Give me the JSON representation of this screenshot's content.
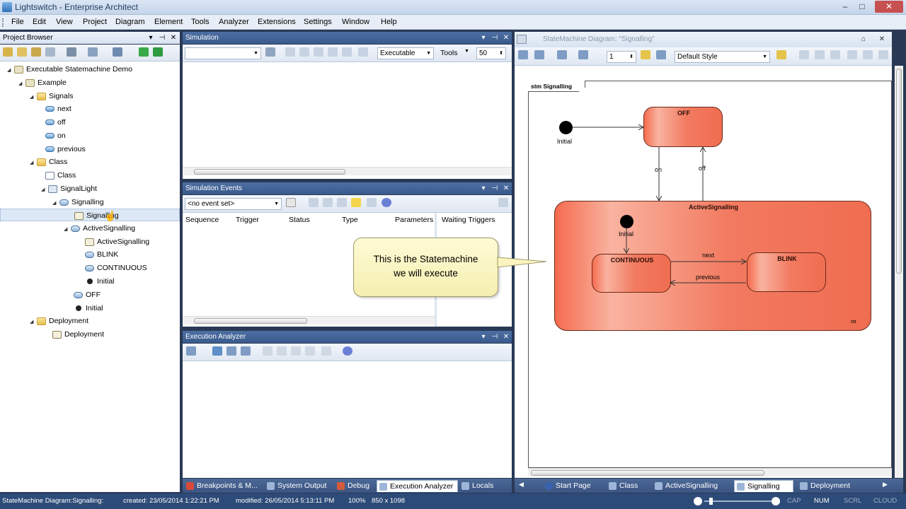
{
  "window": {
    "title": "Lightswitch - Enterprise Architect",
    "minimize": "–",
    "maximize": "□",
    "close": "✕"
  },
  "menu": [
    "File",
    "Edit",
    "View",
    "Project",
    "Diagram",
    "Element",
    "Tools",
    "Analyzer",
    "Extensions",
    "Settings",
    "Window",
    "Help"
  ],
  "project_browser": {
    "title": "Project Browser",
    "items": [
      {
        "label": "Executable Statemachine Demo",
        "icon": "model-icon",
        "expander": "◢"
      },
      {
        "label": "Example",
        "icon": "package-icon",
        "expander": "◢"
      },
      {
        "label": "Signals",
        "icon": "folder-icon",
        "expander": "◢"
      },
      {
        "label": "next",
        "icon": "signal-icon",
        "expander": ""
      },
      {
        "label": "off",
        "icon": "signal-icon",
        "expander": ""
      },
      {
        "label": "on",
        "icon": "signal-icon",
        "expander": ""
      },
      {
        "label": "previous",
        "icon": "signal-icon",
        "expander": ""
      },
      {
        "label": "Class",
        "icon": "folder-icon",
        "expander": "◢"
      },
      {
        "label": "Class",
        "icon": "class-diagram-icon",
        "expander": ""
      },
      {
        "label": "SignalLight",
        "icon": "class-icon",
        "expander": "◢"
      },
      {
        "label": "Signalling",
        "icon": "statemachine-icon",
        "expander": "◢"
      },
      {
        "label": "Signalling",
        "icon": "diagram-icon",
        "expander": ""
      },
      {
        "label": "ActiveSignalling",
        "icon": "state-icon",
        "expander": "◢"
      },
      {
        "label": "ActiveSignalling",
        "icon": "diagram-icon",
        "expander": ""
      },
      {
        "label": "BLINK",
        "icon": "state-icon",
        "expander": ""
      },
      {
        "label": "CONTINUOUS",
        "icon": "state-icon",
        "expander": ""
      },
      {
        "label": "Initial",
        "icon": "initial-icon",
        "expander": ""
      },
      {
        "label": "OFF",
        "icon": "state-icon",
        "expander": ""
      },
      {
        "label": "Initial",
        "icon": "initial-icon",
        "expander": ""
      },
      {
        "label": "Deployment",
        "icon": "folder-icon",
        "expander": "◢"
      },
      {
        "label": "Deployment",
        "icon": "deployment-icon",
        "expander": ""
      }
    ]
  },
  "simulation": {
    "title": "Simulation",
    "mode_select": "Executable",
    "tools_label": "Tools",
    "speed": "50"
  },
  "simulation_events": {
    "title": "Simulation Events",
    "event_set": "<no event set>",
    "columns": [
      "Sequence",
      "Trigger",
      "Status",
      "Type",
      "Parameters"
    ],
    "waiting_triggers": "Waiting Triggers"
  },
  "execution_analyzer": {
    "title": "Execution Analyzer"
  },
  "bottom_tabs": [
    "Breakpoints & M...",
    "System Output",
    "Debug",
    "Execution Analyzer",
    "Locals"
  ],
  "diagram": {
    "title": "StateMachine Diagram: \"Signalling\"",
    "zoom_value": "1",
    "style_select": "Default Style",
    "frame_label": "stm Signalling",
    "states": {
      "off": "OFF",
      "active": "ActiveSignalling",
      "continuous": "CONTINUOUS",
      "blink": "BLINK"
    },
    "initial_label": "Initial",
    "inner_initial_label": "Initial",
    "transitions": {
      "on": "on",
      "off": "off",
      "next": "next",
      "previous": "previous"
    }
  },
  "callout": {
    "line1": "This is the Statemachine",
    "line2": "we will execute"
  },
  "diagram_tabs": [
    "Start Page",
    "Class",
    "ActiveSignalling",
    "Signalling",
    "Deployment"
  ],
  "status": {
    "path": "StateMachine Diagram:Signalling:",
    "created": "created: 23/05/2014 1:22:21 PM",
    "modified": "modified: 26/05/2014 5:13:11 PM",
    "zoom": "100%",
    "size": "850 x 1098",
    "indicators": [
      "CAP",
      "NUM",
      "SCRL",
      "CLOUD"
    ]
  },
  "colors": {
    "state_fill": "#f27a60",
    "state_border": "#6b2a1a",
    "callout_fill": "#fff9cc",
    "panel_header": "#3f5f91",
    "statusbar": "#2d4b78"
  }
}
